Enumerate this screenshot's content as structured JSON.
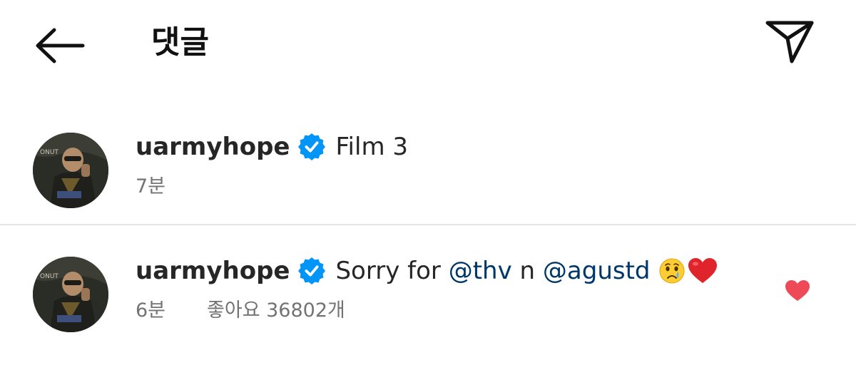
{
  "header": {
    "title": "댓글",
    "back_icon": "arrow-left-icon",
    "share_icon": "paper-plane-icon"
  },
  "comments": [
    {
      "username": "uarmyhope",
      "verified": true,
      "text": "Film 3",
      "time": "7분"
    },
    {
      "username": "uarmyhope",
      "verified": true,
      "text_prefix": "Sorry for",
      "mention1": "@thv",
      "connector": "n",
      "mention2": "@agustd",
      "emojis": [
        "crying-face-emoji",
        "red-heart-emoji"
      ],
      "time": "6분",
      "likes": "좋아요 36802개",
      "liked": true
    }
  ],
  "colors": {
    "text": "#262626",
    "secondary": "#737373",
    "mention": "#00376b",
    "verified": "#0095f6",
    "like": "#ed4956",
    "divider": "#e6e6e6"
  }
}
